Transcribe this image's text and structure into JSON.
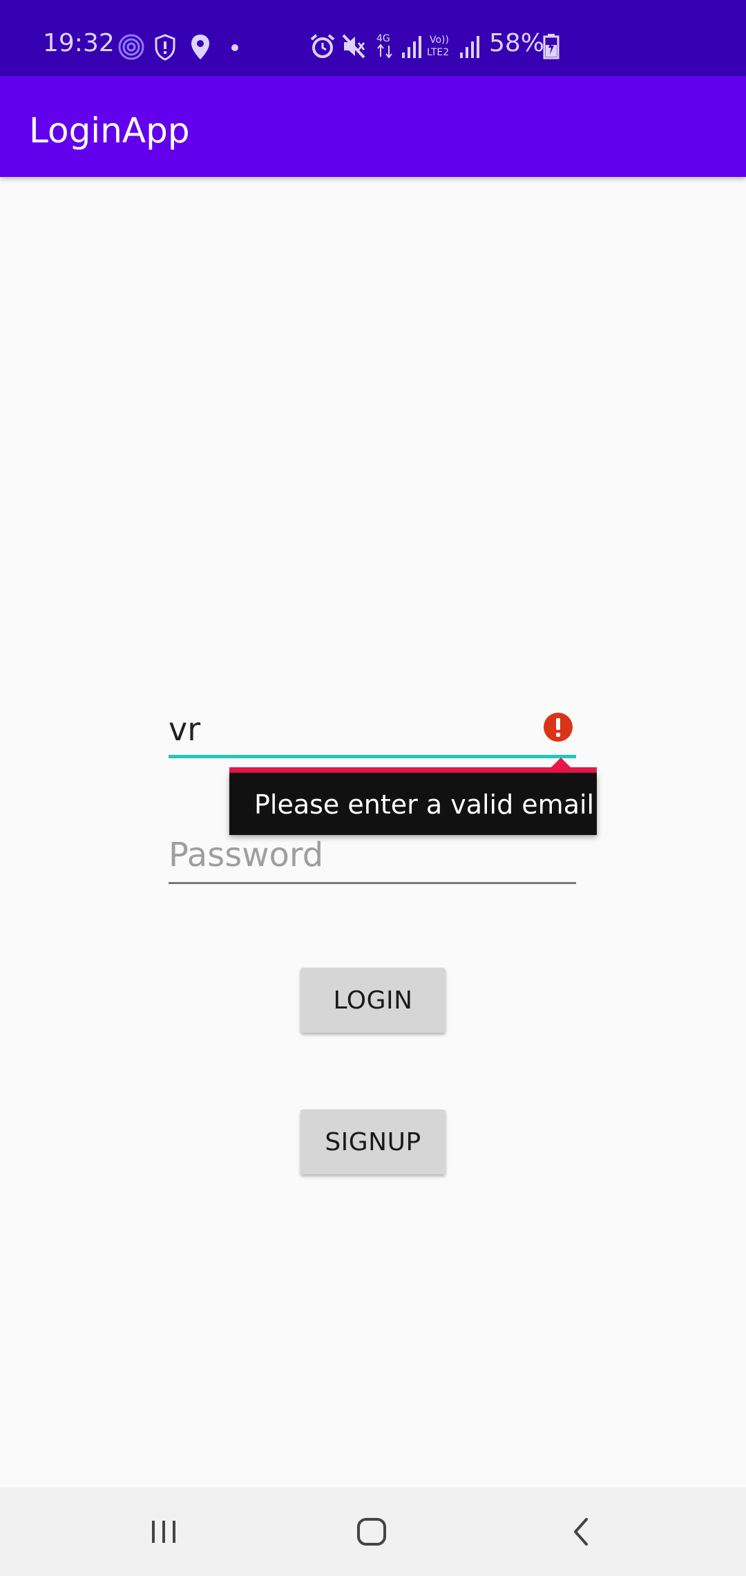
{
  "status_bar": {
    "time": "19:32",
    "battery_percent": "58%",
    "icons": [
      "fingerprint-icon",
      "shield-icon",
      "location-icon",
      "dot-icon",
      "alarm-icon",
      "mute-icon",
      "4g-icon",
      "signal-icon",
      "volte-icon",
      "signal-icon",
      "battery-icon"
    ],
    "background_color": "#3700b3"
  },
  "app_bar": {
    "title": "LoginApp",
    "background_color": "#6200ee"
  },
  "form": {
    "email_value": "vr",
    "email_error": "Please enter a valid email",
    "password_placeholder": "Password",
    "login_label": "LOGIN",
    "signup_label": "SIGNUP",
    "accent_color": "#26c6b6",
    "error_color": "#e8174a"
  },
  "nav_bar": {
    "icons": [
      "recent-apps-icon",
      "home-icon",
      "back-icon"
    ]
  }
}
